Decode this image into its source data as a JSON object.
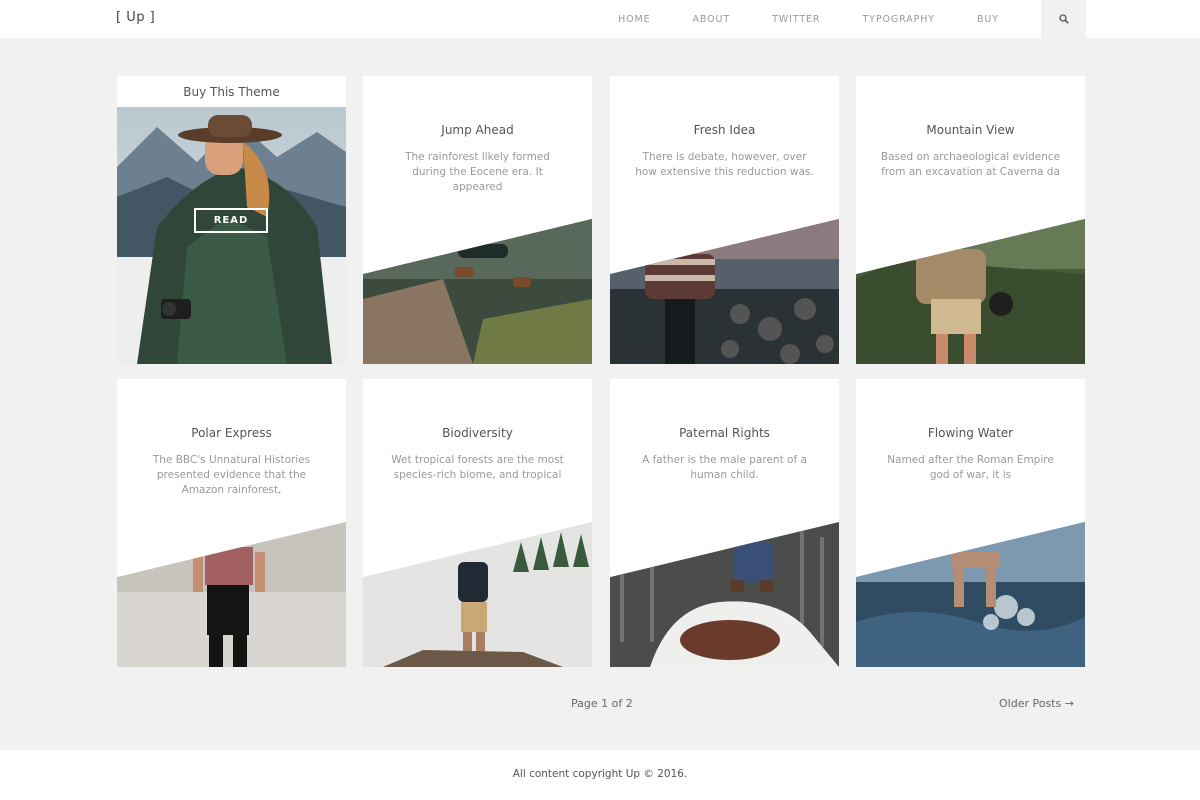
{
  "header": {
    "logo": "[ Up ]",
    "nav": [
      "HOME",
      "ABOUT",
      "TWITTER",
      "TYPOGRAPHY",
      "BUY"
    ],
    "search_icon": "search-icon"
  },
  "featured": {
    "title": "Buy This Theme",
    "button_label": "READ"
  },
  "posts": [
    {
      "title": "Jump Ahead",
      "excerpt": "The rainforest likely formed during the Eocene era. It appeared"
    },
    {
      "title": "Fresh Idea",
      "excerpt": "There is debate, however, over how extensive this reduction was."
    },
    {
      "title": "Mountain View",
      "excerpt": "Based on archaeological evidence from an excavation at Caverna da"
    },
    {
      "title": "Polar Express",
      "excerpt": "The BBC's Unnatural Histories presented evidence that the Amazon rainforest,"
    },
    {
      "title": "Biodiversity",
      "excerpt": "Wet tropical forests are the most species-rich biome, and tropical"
    },
    {
      "title": "Paternal Rights",
      "excerpt": "A father is the male parent of a human child."
    },
    {
      "title": "Flowing Water",
      "excerpt": "Named after the Roman Empire god of war, it is"
    }
  ],
  "pagination": {
    "page_info": "Page 1 of 2",
    "older_posts": "Older Posts →"
  },
  "footer": {
    "copyright": "All content copyright Up © 2016."
  }
}
